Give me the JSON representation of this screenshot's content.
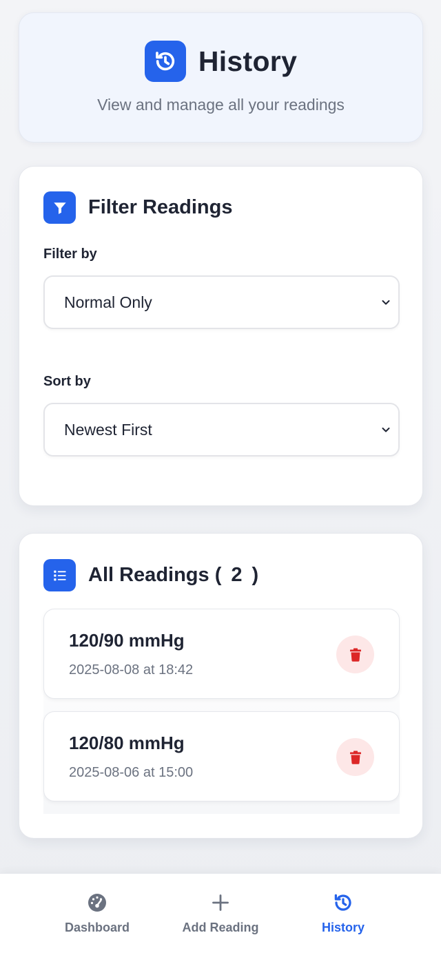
{
  "header": {
    "title": "History",
    "subtitle": "View and manage all your readings",
    "icon": "history-icon"
  },
  "filter_card": {
    "title": "Filter Readings",
    "icon": "filter-icon",
    "filter_label": "Filter by",
    "filter_value": "Normal Only",
    "sort_label": "Sort by",
    "sort_value": "Newest First"
  },
  "readings_card": {
    "title_prefix": "All Readings (",
    "count": "2",
    "title_suffix": ")",
    "icon": "list-icon",
    "items": [
      {
        "value": "120/90 mmHg",
        "date": "2025-08-08 at 18:42"
      },
      {
        "value": "120/80 mmHg",
        "date": "2025-08-06 at 15:00"
      }
    ]
  },
  "nav": {
    "items": [
      {
        "label": "Dashboard",
        "icon": "gauge-icon",
        "active": false
      },
      {
        "label": "Add Reading",
        "icon": "plus-icon",
        "active": false
      },
      {
        "label": "History",
        "icon": "history-icon",
        "active": true
      }
    ]
  },
  "colors": {
    "accent": "#2563eb",
    "danger": "#dc2626",
    "danger_bg": "#fde7e7",
    "text_primary": "#1f2433",
    "text_secondary": "#6b7280"
  }
}
